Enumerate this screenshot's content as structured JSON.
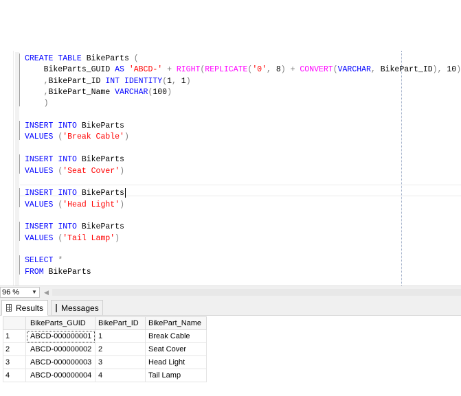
{
  "editor": {
    "code_lines": [
      [
        [
          "kw",
          "CREATE"
        ],
        [
          "id",
          " "
        ],
        [
          "kw",
          "TABLE"
        ],
        [
          "id",
          " BikeParts "
        ],
        [
          "op",
          "("
        ]
      ],
      [
        [
          "id",
          "    BikeParts_GUID "
        ],
        [
          "kw",
          "AS"
        ],
        [
          "id",
          " "
        ],
        [
          "str",
          "'ABCD-'"
        ],
        [
          "id",
          " "
        ],
        [
          "op",
          "+"
        ],
        [
          "id",
          " "
        ],
        [
          "fn",
          "RIGHT"
        ],
        [
          "op",
          "("
        ],
        [
          "fn",
          "REPLICATE"
        ],
        [
          "op",
          "("
        ],
        [
          "str",
          "'0'"
        ],
        [
          "op",
          ","
        ],
        [
          "id",
          " 8"
        ],
        [
          "op",
          ")"
        ],
        [
          "id",
          " "
        ],
        [
          "op",
          "+"
        ],
        [
          "id",
          " "
        ],
        [
          "fn",
          "CONVERT"
        ],
        [
          "op",
          "("
        ],
        [
          "kw",
          "VARCHAR"
        ],
        [
          "op",
          ","
        ],
        [
          "id",
          " BikePart_ID"
        ],
        [
          "op",
          ")"
        ],
        [
          "op",
          ","
        ],
        [
          "id",
          " 10"
        ],
        [
          "op",
          ")"
        ]
      ],
      [
        [
          "id",
          "    "
        ],
        [
          "op",
          ","
        ],
        [
          "id",
          "BikePart_ID "
        ],
        [
          "kw",
          "INT"
        ],
        [
          "id",
          " "
        ],
        [
          "kw",
          "IDENTITY"
        ],
        [
          "op",
          "("
        ],
        [
          "id",
          "1"
        ],
        [
          "op",
          ","
        ],
        [
          "id",
          " 1"
        ],
        [
          "op",
          ")"
        ]
      ],
      [
        [
          "id",
          "    "
        ],
        [
          "op",
          ","
        ],
        [
          "id",
          "BikePart_Name "
        ],
        [
          "kw",
          "VARCHAR"
        ],
        [
          "op",
          "("
        ],
        [
          "id",
          "100"
        ],
        [
          "op",
          ")"
        ]
      ],
      [
        [
          "id",
          "    "
        ],
        [
          "op",
          ")"
        ]
      ],
      [],
      [
        [
          "kw",
          "INSERT"
        ],
        [
          "id",
          " "
        ],
        [
          "kw",
          "INTO"
        ],
        [
          "id",
          " BikeParts"
        ]
      ],
      [
        [
          "kw",
          "VALUES"
        ],
        [
          "id",
          " "
        ],
        [
          "op",
          "("
        ],
        [
          "str",
          "'Break Cable'"
        ],
        [
          "op",
          ")"
        ]
      ],
      [],
      [
        [
          "kw",
          "INSERT"
        ],
        [
          "id",
          " "
        ],
        [
          "kw",
          "INTO"
        ],
        [
          "id",
          " BikeParts"
        ]
      ],
      [
        [
          "kw",
          "VALUES"
        ],
        [
          "id",
          " "
        ],
        [
          "op",
          "("
        ],
        [
          "str",
          "'Seat Cover'"
        ],
        [
          "op",
          ")"
        ]
      ],
      [],
      [
        [
          "kw",
          "INSERT"
        ],
        [
          "id",
          " "
        ],
        [
          "kw",
          "INTO"
        ],
        [
          "id",
          " BikeParts"
        ]
      ],
      [
        [
          "kw",
          "VALUES"
        ],
        [
          "id",
          " "
        ],
        [
          "op",
          "("
        ],
        [
          "str",
          "'Head Light'"
        ],
        [
          "op",
          ")"
        ]
      ],
      [],
      [
        [
          "kw",
          "INSERT"
        ],
        [
          "id",
          " "
        ],
        [
          "kw",
          "INTO"
        ],
        [
          "id",
          " BikeParts"
        ]
      ],
      [
        [
          "kw",
          "VALUES"
        ],
        [
          "id",
          " "
        ],
        [
          "op",
          "("
        ],
        [
          "str",
          "'Tail Lamp'"
        ],
        [
          "op",
          ")"
        ]
      ],
      [],
      [
        [
          "kw",
          "SELECT"
        ],
        [
          "id",
          " "
        ],
        [
          "op",
          "*"
        ]
      ],
      [
        [
          "kw",
          "FROM"
        ],
        [
          "id",
          " BikeParts"
        ]
      ]
    ],
    "caret_line": 12
  },
  "zoom": {
    "label": "96 %"
  },
  "tabs": {
    "results_label": "Results",
    "messages_label": "Messages"
  },
  "results": {
    "columns": [
      "BikeParts_GUID",
      "BikePart_ID",
      "BikePart_Name"
    ],
    "rows": [
      {
        "num": "1",
        "guid": "ABCD-000000001",
        "id": "1",
        "name": "Break Cable"
      },
      {
        "num": "2",
        "guid": "ABCD-000000002",
        "id": "2",
        "name": "Seat Cover"
      },
      {
        "num": "3",
        "guid": "ABCD-000000003",
        "id": "3",
        "name": "Head Light"
      },
      {
        "num": "4",
        "guid": "ABCD-000000004",
        "id": "4",
        "name": "Tail Lamp"
      }
    ]
  },
  "colors": {
    "keyword": "#0000ff",
    "string": "#ff0000",
    "function": "#ff00ff",
    "operator": "#808080"
  }
}
